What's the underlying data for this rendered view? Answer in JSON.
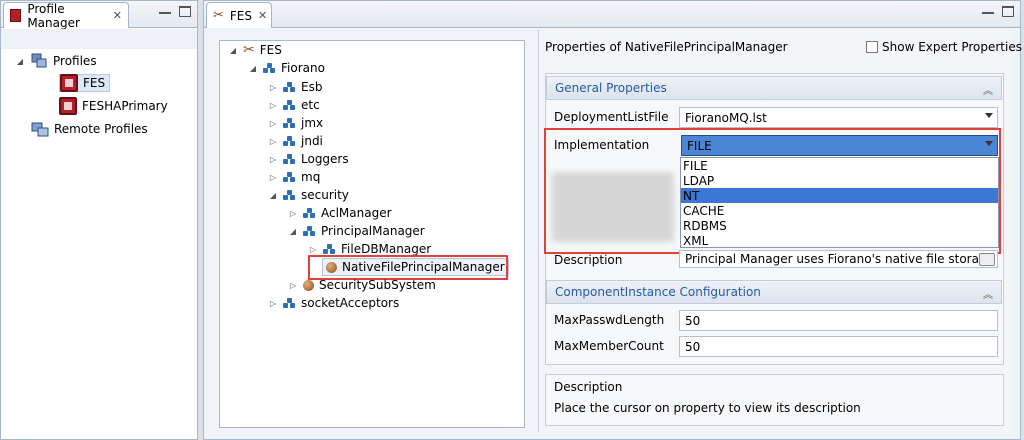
{
  "left_panel": {
    "tab_title": "Profile Manager",
    "tree": [
      {
        "label": "Profiles"
      },
      {
        "label": "FES"
      },
      {
        "label": "FESHAPrimary"
      },
      {
        "label": "Remote Profiles"
      }
    ]
  },
  "editor": {
    "tab_title": "FES",
    "tree": {
      "root": "FES",
      "fiorano": "Fiorano",
      "items": [
        "Esb",
        "etc",
        "jmx",
        "jndi",
        "Loggers",
        "mq"
      ],
      "security": "security",
      "acl_manager": "AclManager",
      "principal_manager": "PrincipalManager",
      "file_db_manager": "FileDBManager",
      "native_file_principal_manager": "NativeFilePrincipalManager",
      "security_subsystem": "SecuritySubSystem",
      "socket_acceptors": "socketAcceptors"
    }
  },
  "properties": {
    "title": "Properties of NativeFilePrincipalManager",
    "show_expert_label": "Show Expert Properties",
    "general_section": "General Properties",
    "deployment_label": "DeploymentListFile",
    "deployment_value": "FioranoMQ.lst",
    "implementation_label": "Implementation",
    "implementation_value": "FILE",
    "dropdown_options": [
      "FILE",
      "LDAP",
      "NT",
      "CACHE",
      "RDBMS",
      "XML"
    ],
    "dropdown_highlighted": "NT",
    "description_label": "Description",
    "description_value": "Principal Manager uses Fiorano's native file storage of u",
    "component_section": "ComponentInstance Configuration",
    "max_passwd_label": "MaxPasswdLength",
    "max_passwd_value": "50",
    "max_member_label": "MaxMemberCount",
    "max_member_value": "50",
    "desc_box_title": "Description",
    "desc_box_text": "Place the cursor on property to view its description"
  },
  "colors": {
    "highlight_red": "#e0413a",
    "selection_blue": "#3a78d4",
    "section_text": "#2559a8"
  }
}
